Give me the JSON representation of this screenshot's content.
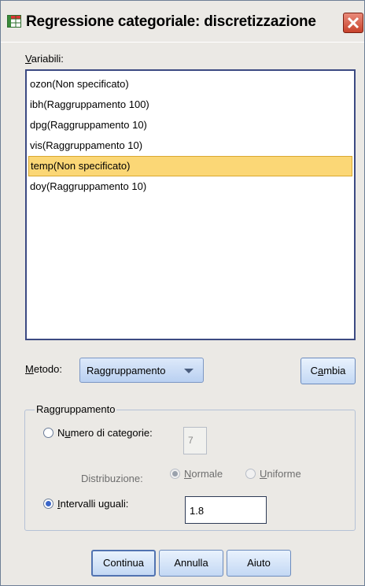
{
  "window": {
    "title": "Regressione categoriale: discretizzazione"
  },
  "variables": {
    "label": "Variabili:",
    "label_access_key": "V",
    "items": [
      {
        "label": "ozon(Non specificato)",
        "selected": false
      },
      {
        "label": "ibh(Raggruppamento 100)",
        "selected": false
      },
      {
        "label": "dpg(Raggruppamento 10)",
        "selected": false
      },
      {
        "label": "vis(Raggruppamento 10)",
        "selected": false
      },
      {
        "label": "temp(Non specificato)",
        "selected": true
      },
      {
        "label": "doy(Raggruppamento 10)",
        "selected": false
      }
    ]
  },
  "method": {
    "label": "Metodo:",
    "value": "Raggruppamento",
    "change_button": "Cambia"
  },
  "grouping": {
    "legend": "Raggruppamento",
    "num_categories_label": "Numero di categorie:",
    "num_categories_value": "7",
    "num_categories_checked": false,
    "distribution_label": "Distribuzione:",
    "normal_label": "Normale",
    "normal_checked": true,
    "uniform_label": "Uniforme",
    "uniform_checked": false,
    "equal_intervals_label": "Intervalli uguali:",
    "equal_intervals_checked": true,
    "equal_intervals_value": "1.8"
  },
  "buttons": {
    "continue": "Continua",
    "cancel": "Annulla",
    "help": "Aiuto"
  },
  "colors": {
    "selection": "#fbd776",
    "accent": "#3a66c9",
    "close": "#c8422b"
  }
}
